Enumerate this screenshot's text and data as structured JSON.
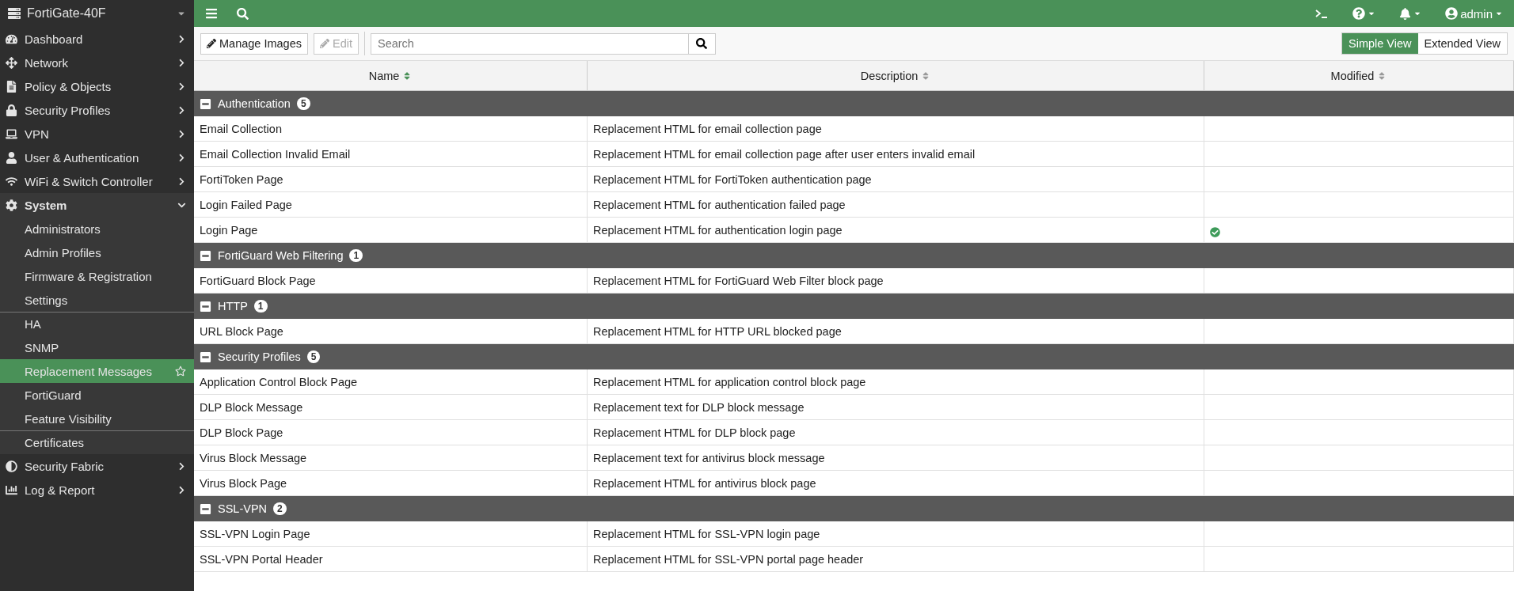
{
  "sidebar": {
    "device": "FortiGate-40F",
    "items": [
      {
        "label": "Dashboard",
        "expanded": false
      },
      {
        "label": "Network",
        "expanded": false
      },
      {
        "label": "Policy & Objects",
        "expanded": false
      },
      {
        "label": "Security Profiles",
        "expanded": false
      },
      {
        "label": "VPN",
        "expanded": false
      },
      {
        "label": "User & Authentication",
        "expanded": false
      },
      {
        "label": "WiFi & Switch Controller",
        "expanded": false
      },
      {
        "label": "System",
        "expanded": true,
        "children": [
          {
            "label": "Administrators",
            "selected": false,
            "separated": false
          },
          {
            "label": "Admin Profiles",
            "selected": false,
            "separated": false
          },
          {
            "label": "Firmware & Registration",
            "selected": false,
            "separated": false
          },
          {
            "label": "Settings",
            "selected": false,
            "separated": false
          },
          {
            "label": "HA",
            "selected": false,
            "separated": true
          },
          {
            "label": "SNMP",
            "selected": false,
            "separated": false
          },
          {
            "label": "Replacement Messages",
            "selected": true,
            "separated": false
          },
          {
            "label": "FortiGuard",
            "selected": false,
            "separated": false
          },
          {
            "label": "Feature Visibility",
            "selected": false,
            "separated": false
          },
          {
            "label": "Certificates",
            "selected": false,
            "separated": true
          }
        ]
      },
      {
        "label": "Security Fabric",
        "expanded": false
      },
      {
        "label": "Log & Report",
        "expanded": false
      }
    ]
  },
  "topbar": {
    "user": "admin"
  },
  "toolbar": {
    "buttons": [
      {
        "label": "Manage Images",
        "disabled": false
      },
      {
        "label": "Edit",
        "disabled": true
      }
    ],
    "search": {
      "placeholder": "Search"
    },
    "views": [
      {
        "label": "Simple View",
        "selected": true
      },
      {
        "label": "Extended View",
        "selected": false
      }
    ]
  },
  "table": {
    "columns": [
      "Name",
      "Description",
      "Modified"
    ],
    "groups": [
      {
        "name": "Authentication",
        "count": "5",
        "rows": [
          {
            "name": "Email Collection",
            "description": "Replacement HTML for email collection page",
            "modified": false
          },
          {
            "name": "Email Collection Invalid Email",
            "description": "Replacement HTML for email collection page after user enters invalid email",
            "modified": false
          },
          {
            "name": "FortiToken Page",
            "description": "Replacement HTML for FortiToken authentication page",
            "modified": false
          },
          {
            "name": "Login Failed Page",
            "description": "Replacement HTML for authentication failed page",
            "modified": false
          },
          {
            "name": "Login Page",
            "description": "Replacement HTML for authentication login page",
            "modified": true
          }
        ]
      },
      {
        "name": "FortiGuard Web Filtering",
        "count": "1",
        "rows": [
          {
            "name": "FortiGuard Block Page",
            "description": "Replacement HTML for FortiGuard Web Filter block page",
            "modified": false
          }
        ]
      },
      {
        "name": "HTTP",
        "count": "1",
        "rows": [
          {
            "name": "URL Block Page",
            "description": "Replacement HTML for HTTP URL blocked page",
            "modified": false
          }
        ]
      },
      {
        "name": "Security Profiles",
        "count": "5",
        "rows": [
          {
            "name": "Application Control Block Page",
            "description": "Replacement HTML for application control block page",
            "modified": false
          },
          {
            "name": "DLP Block Message",
            "description": "Replacement text for DLP block message",
            "modified": false
          },
          {
            "name": "DLP Block Page",
            "description": "Replacement HTML for DLP block page",
            "modified": false
          },
          {
            "name": "Virus Block Message",
            "description": "Replacement text for antivirus block message",
            "modified": false
          },
          {
            "name": "Virus Block Page",
            "description": "Replacement HTML for antivirus block page",
            "modified": false
          }
        ]
      },
      {
        "name": "SSL-VPN",
        "count": "2",
        "rows": [
          {
            "name": "SSL-VPN Login Page",
            "description": "Replacement HTML for SSL-VPN login page",
            "modified": false
          },
          {
            "name": "SSL-VPN Portal Header",
            "description": "Replacement HTML for SSL-VPN portal page header",
            "modified": false
          }
        ]
      }
    ]
  }
}
